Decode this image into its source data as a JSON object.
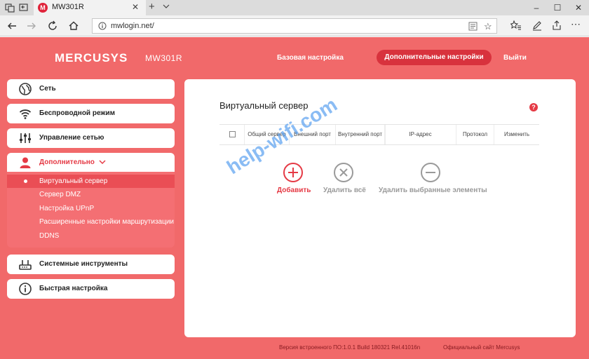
{
  "browser": {
    "tab_title": "MW301R",
    "tab_favicon_letter": "M",
    "url": "mwlogin.net/",
    "window_controls": [
      "–",
      "☐",
      "✕"
    ]
  },
  "header": {
    "logo": "MERCUSYS",
    "model": "MW301R",
    "nav": {
      "basic": "Базовая настройка",
      "advanced": "Дополнительные настройки",
      "logout": "Выйти"
    }
  },
  "sidebar": {
    "items": [
      {
        "label": "Сеть",
        "icon": "globe-icon"
      },
      {
        "label": "Беспроводной режим",
        "icon": "wifi-icon"
      },
      {
        "label": "Управление сетью",
        "icon": "sliders-icon"
      },
      {
        "label": "Дополнительно",
        "icon": "user-icon"
      },
      {
        "label": "Системные инструменты",
        "icon": "router-icon"
      },
      {
        "label": "Быстрая настройка",
        "icon": "info-icon"
      }
    ],
    "submenu": [
      "Виртуальный сервер",
      "Сервер DMZ",
      "Настройка UPnP",
      "Расширенные настройки маршрутизации",
      "DDNS"
    ]
  },
  "panel": {
    "title": "Виртуальный сервер",
    "help_icon": "?",
    "table_headers": [
      "Общий сервер",
      "Внешний порт",
      "Внутренний порт",
      "IP-адрес",
      "Протокол",
      "Изменить"
    ],
    "actions": {
      "add": "Добавить",
      "delete_all": "Удалить всё",
      "delete_selected": "Удалить выбранные элементы"
    }
  },
  "footer": {
    "firmware": "Версия встроенного ПО:1.0.1 Build 180321 Rel.41016n",
    "site": "Официальный сайт Mercusys"
  },
  "watermark": "help-wifi.com",
  "colors": {
    "page_bg": "#f1696a",
    "accent": "#e53a45",
    "submenu_bg": "#f46f73"
  }
}
